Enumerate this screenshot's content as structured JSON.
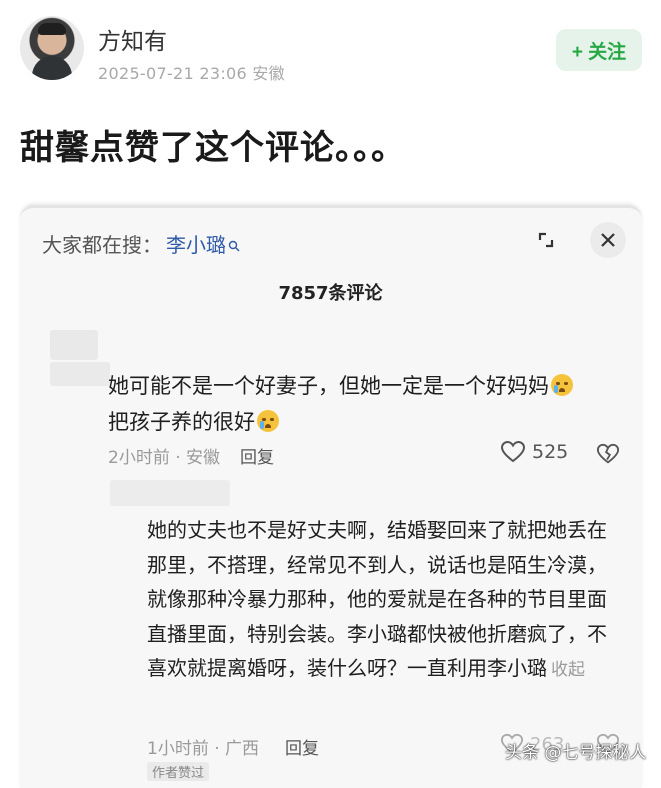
{
  "post": {
    "author": "方知有",
    "meta": "2025-07-21 23:06 安徽",
    "follow_label": "+ 关注",
    "text": "甜馨点赞了这个评论。。。"
  },
  "sheet": {
    "search_prefix": "大家都在搜：",
    "search_term": "李小璐",
    "search_icon": "search-icon",
    "comment_count": "7857条评论",
    "close_icon": "close-icon",
    "expand_icon": "expand-icon"
  },
  "comment1": {
    "line1": "她可能不是一个好妻子，但她一定是一个好妈妈",
    "line2": "把孩子养的很好",
    "time_location": "2小时前 · 安徽",
    "reply_label": "回复",
    "likes": "525"
  },
  "comment2": {
    "text": "她的丈夫也不是好丈夫啊，结婚娶回来了就把她丢在那里，不搭理，经常见不到人，说话也是陌生冷漠，就像那种冷暴力那种，他的爱就是在各种的节目里面直播里面，特别会装。李小璐都快被他折磨疯了，不喜欢就提离婚呀，装什么呀？一直利用李小璐",
    "collapse_label": "收起",
    "time_location": "1小时前 · 广西",
    "reply_label": "回复",
    "likes": "263",
    "author_badge": "作者赞过"
  },
  "watermark": "头条 @七号探秘人",
  "colors": {
    "follow_green": "#28a745",
    "link_blue": "#2f5aa8",
    "muted": "#9a9a9a"
  }
}
